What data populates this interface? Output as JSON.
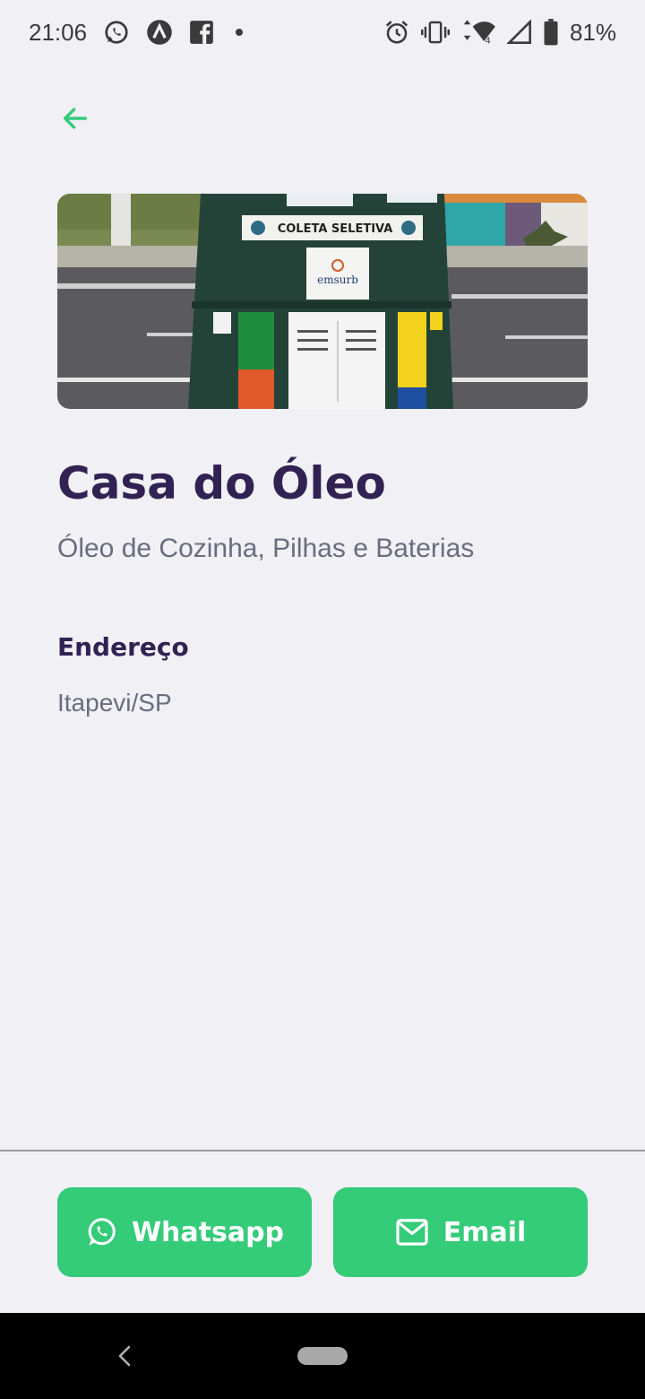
{
  "status_bar": {
    "time": "21:06",
    "battery": "81%",
    "notification_icons": [
      "whatsapp-icon",
      "app-a-icon",
      "facebook-icon",
      "dot-icon"
    ],
    "system_icons": [
      "alarm-icon",
      "vibrate-icon",
      "wifi-icon",
      "signal-icon",
      "battery-icon"
    ]
  },
  "header": {
    "back_icon": "arrow-left-icon"
  },
  "point": {
    "image_alt": "COLETA SELETIVA",
    "title": "Casa do Óleo",
    "items": "Óleo de Cozinha, Pilhas e Baterias",
    "address_label": "Endereço",
    "address_value": "Itapevi/SP"
  },
  "footer": {
    "whatsapp_label": "Whatsapp",
    "email_label": "Email"
  },
  "colors": {
    "background": "#f0f0f5",
    "title": "#322153",
    "text": "#6c6c80",
    "accent": "#34cb79"
  }
}
